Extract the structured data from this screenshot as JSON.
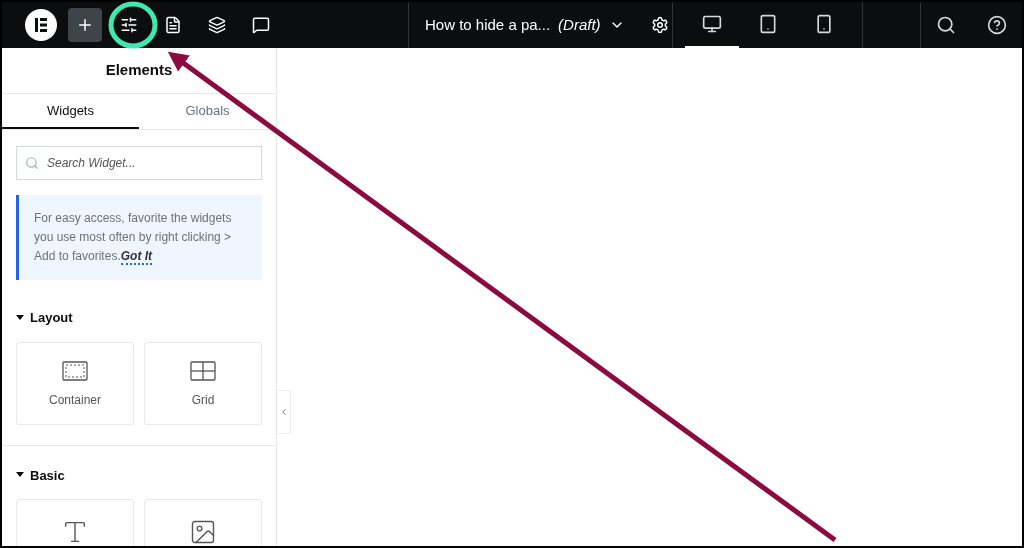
{
  "toolbar": {
    "tools": [
      {
        "kind": "logo",
        "selected": false
      },
      {
        "kind": "add",
        "selected": true
      },
      {
        "kind": "settings",
        "selected": false,
        "highlighted": true
      },
      {
        "kind": "page",
        "selected": false
      },
      {
        "kind": "layers",
        "selected": false
      },
      {
        "kind": "comments",
        "selected": false
      }
    ],
    "document": {
      "title": "How to hide a pa...",
      "status": "(Draft)"
    },
    "devices": [
      {
        "kind": "desktop",
        "selected": true
      },
      {
        "kind": "tablet",
        "selected": false
      },
      {
        "kind": "mobile",
        "selected": false
      }
    ]
  },
  "panel": {
    "title": "Elements",
    "tabs": [
      {
        "label": "Widgets",
        "selected": true
      },
      {
        "label": "Globals",
        "selected": false
      }
    ],
    "search": {
      "placeholder": "Search Widget..."
    },
    "tip": {
      "text": "For easy access, favorite the widgets you use most often by right clicking > Add to favorites.",
      "link": "Got It"
    },
    "categories": [
      {
        "name": "Layout",
        "expanded": true,
        "widgets": [
          {
            "kind": "container",
            "label": "Container"
          },
          {
            "kind": "grid",
            "label": "Grid"
          }
        ]
      },
      {
        "name": "Basic",
        "expanded": true,
        "widgets": [
          {
            "kind": "heading"
          },
          {
            "kind": "image"
          }
        ]
      }
    ]
  }
}
